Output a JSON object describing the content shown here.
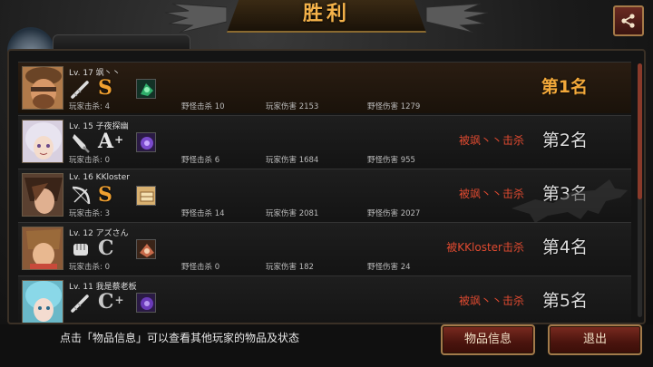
{
  "header": {
    "title": "胜利"
  },
  "players": [
    {
      "level_name": "Lv. 17 飒丶丶",
      "grade": "S",
      "grade_plus": "",
      "player_kills": "玩家击杀: 4",
      "monster_kills": "野怪击杀 10",
      "player_damage": "玩家伤害 2153",
      "monster_damage": "野怪伤害 1279",
      "killed_by": "",
      "rank": "第1名"
    },
    {
      "level_name": "Lv. 15 子夜探幽",
      "grade": "A",
      "grade_plus": "+",
      "player_kills": "玩家击杀: 0",
      "monster_kills": "野怪击杀 6",
      "player_damage": "玩家伤害 1684",
      "monster_damage": "野怪伤害 955",
      "killed_by": "被飒丶丶击杀",
      "rank": "第2名"
    },
    {
      "level_name": "Lv. 16 KKloster",
      "grade": "S",
      "grade_plus": "",
      "player_kills": "玩家击杀: 3",
      "monster_kills": "野怪击杀 14",
      "player_damage": "玩家伤害 2081",
      "monster_damage": "野怪伤害 2027",
      "killed_by": "被飒丶丶击杀",
      "rank": "第3名"
    },
    {
      "level_name": "Lv. 12 アズさん",
      "grade": "C",
      "grade_plus": "",
      "player_kills": "玩家击杀: 0",
      "monster_kills": "野怪击杀 0",
      "player_damage": "玩家伤害 182",
      "monster_damage": "野怪伤害 24",
      "killed_by": "被KKloster击杀",
      "rank": "第4名"
    },
    {
      "level_name": "Lv. 11 我是蔡老板",
      "grade": "C",
      "grade_plus": "+",
      "player_kills": "",
      "monster_kills": "",
      "player_damage": "",
      "monster_damage": "",
      "killed_by": "被飒丶丶击杀",
      "rank": "第5名"
    }
  ],
  "footer": {
    "hint": "点击「物品信息」可以查看其他玩家的物品及状态",
    "items_button": "物品信息",
    "exit_button": "退出"
  },
  "icons": {
    "share": "share-icon",
    "weapons": [
      "club-icon",
      "knife-icon",
      "bow-icon",
      "fist-icon",
      "club-icon"
    ]
  },
  "colors": {
    "accent_gold": "#f4b24a",
    "killed_by_red": "#e04a30",
    "button_red": "#7a2a20"
  }
}
